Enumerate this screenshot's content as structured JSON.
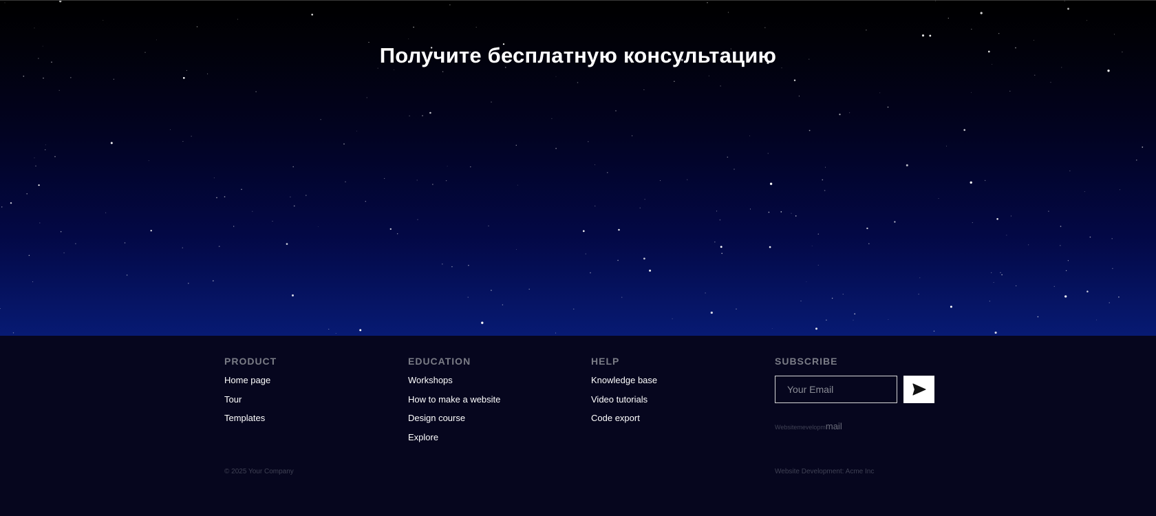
{
  "hero": {
    "title": "Получите бесплатную консультацию"
  },
  "footer": {
    "product": {
      "title": "PRODUCT",
      "links": [
        "Home page",
        "Tour",
        "Templates"
      ]
    },
    "education": {
      "title": "EDUCATION",
      "links": [
        "Workshops",
        "How to make a website",
        "Design course",
        "Explore"
      ]
    },
    "help": {
      "title": "HELP",
      "links": [
        "Knowledge base",
        "Video tutorials",
        "Code export"
      ]
    },
    "subscribe": {
      "title": "SUBSCRIBE",
      "email_placeholder": "Your Email",
      "send_icon": "send-arrow-icon",
      "mailer_note_small": "Websitemevelopm",
      "mailer_note_mail": "mail"
    },
    "copyright": "© 2025 Your Company",
    "dev_credit": "Website Development: Acme Inc"
  },
  "colors": {
    "hero_top": "#000000",
    "hero_bottom": "#071a73",
    "footer_bg": "#06061e",
    "footer_heading": "#7a7c86",
    "footer_link": "#ffffff"
  }
}
